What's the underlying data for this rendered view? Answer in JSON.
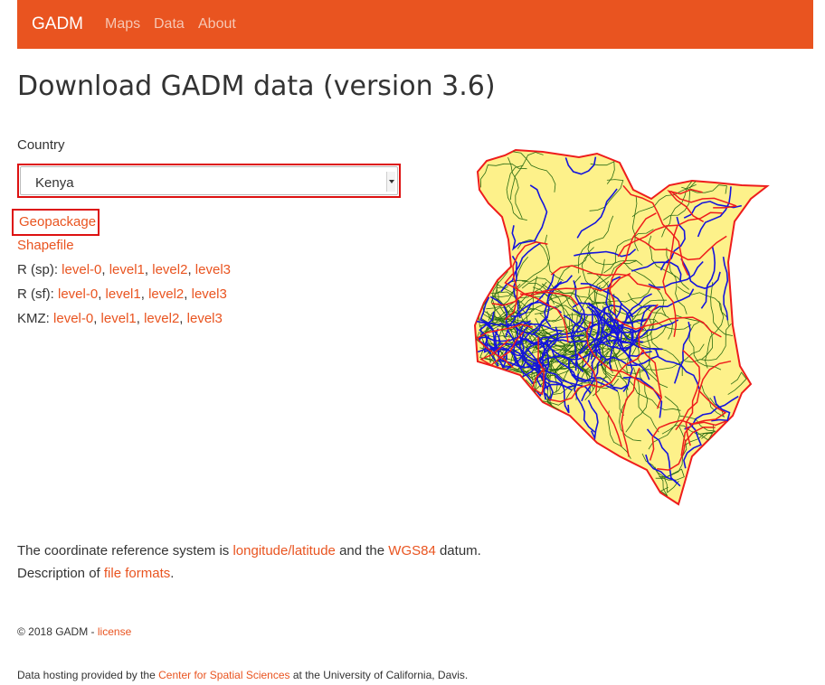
{
  "navbar": {
    "brand": "GADM",
    "links": [
      "Maps",
      "Data",
      "About"
    ]
  },
  "page": {
    "title": "Download GADM data (version 3.6)"
  },
  "form": {
    "country_label": "Country",
    "country_selected": "Kenya"
  },
  "downloads": {
    "geopackage": "Geopackage",
    "shapefile": "Shapefile",
    "r_sp": {
      "label": "R (sp):",
      "links": [
        "level-0",
        "level1",
        "level2",
        "level3"
      ]
    },
    "r_sf": {
      "label": "R (sf):",
      "links": [
        "level-0",
        "level1",
        "level2",
        "level3"
      ]
    },
    "kmz": {
      "label": "KMZ:",
      "links": [
        "level-0",
        "level1",
        "level2",
        "level3"
      ]
    },
    "separator": ", "
  },
  "info": {
    "crs_prefix": "The coordinate reference system is",
    "crs_link": "longitude/latitude",
    "crs_middle": "and the",
    "datum_link": "WGS84",
    "datum_suffix": "datum.",
    "desc_prefix": "Description of",
    "desc_link": "file formats",
    "desc_suffix": "."
  },
  "footer": {
    "copyright": "© 2018 GADM -",
    "license_link": "license",
    "hosting_prefix": "Data hosting provided by the",
    "hosting_link": "Center for Spatial Sciences",
    "hosting_suffix": "at the University of California, Davis."
  },
  "map": {
    "name": "Kenya",
    "fill": "#fdf18a",
    "colors": {
      "border": "#ee1c1c",
      "level1": "#1414dd",
      "level3": "#2a6b12"
    }
  },
  "colors": {
    "accent": "#e95420",
    "highlight": "#dd1111"
  }
}
